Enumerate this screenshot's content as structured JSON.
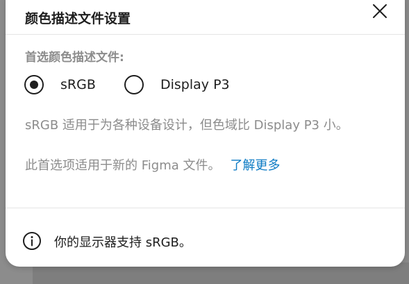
{
  "dialog": {
    "title": "颜色描述文件设置",
    "close_icon": "close-icon"
  },
  "profile": {
    "section_label": "首选颜色描述文件:",
    "options": [
      {
        "label": "sRGB",
        "selected": true
      },
      {
        "label": "Display P3",
        "selected": false
      }
    ]
  },
  "description": "sRGB 适用于为各种设备设计，但色域比 Display P3 小。",
  "note": {
    "text": "此首选项适用于新的 Figma 文件。",
    "link_label": "了解更多",
    "link_color": "#0d7bc4"
  },
  "footer": {
    "icon": "info-icon",
    "text": "你的显示器支持 sRGB。"
  }
}
